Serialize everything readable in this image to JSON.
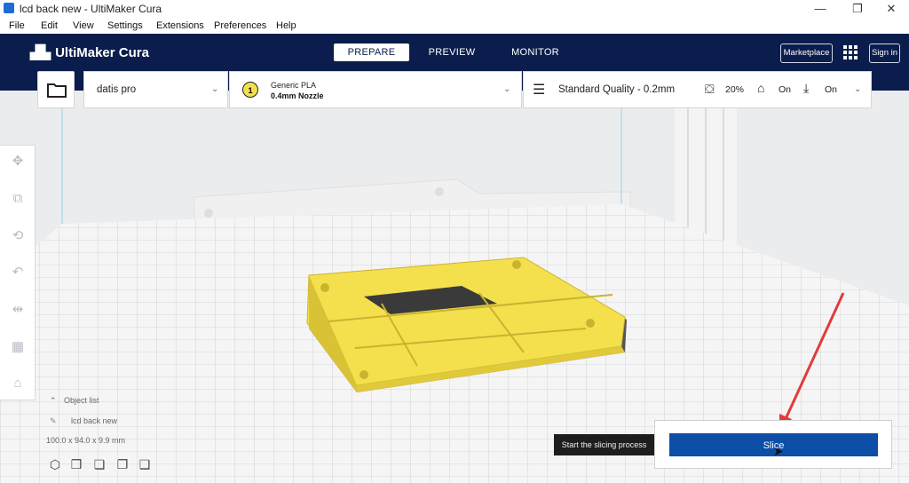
{
  "window": {
    "title": "lcd back new - UltiMaker Cura"
  },
  "menu": [
    "File",
    "Edit",
    "View",
    "Settings",
    "Extensions",
    "Preferences",
    "Help"
  ],
  "header": {
    "logo": "UltiMaker Cura",
    "tabs": [
      "PREPARE",
      "PREVIEW",
      "MONITOR"
    ],
    "marketplace": "Marketplace",
    "signin": "Sign in"
  },
  "printer": {
    "name": "datis pro"
  },
  "material": {
    "extruder": "1",
    "name": "Generic PLA",
    "nozzle": "0.4mm Nozzle"
  },
  "print_settings": {
    "profile": "Standard Quality - 0.2mm",
    "infill": "20%",
    "support": "On",
    "adhesion": "On"
  },
  "object": {
    "list_label": "Object list",
    "name": "lcd back new",
    "dimensions": "100.0 x 94.0 x 9.9 mm"
  },
  "slice": {
    "tooltip": "Start the slicing process",
    "button": "Slice"
  },
  "colors": {
    "header": "#0b1d4d",
    "accent": "#0d4ea6",
    "model": "#f4e04d"
  }
}
